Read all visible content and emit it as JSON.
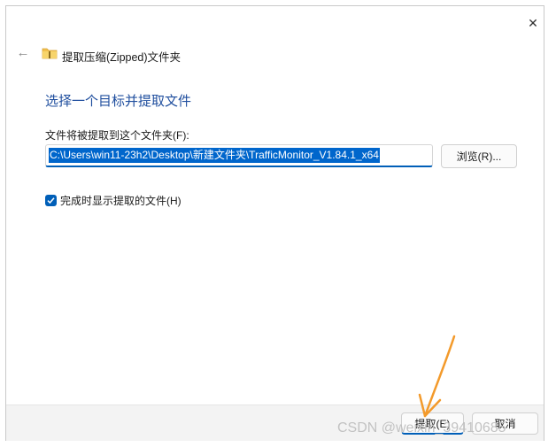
{
  "dialog": {
    "title": "提取压缩(Zipped)文件夹",
    "close_icon": "close-icon",
    "back_icon": "back-arrow-icon",
    "folder_icon": "zip-folder-icon"
  },
  "main": {
    "heading": "选择一个目标并提取文件",
    "destination_label": "文件将被提取到这个文件夹(F):",
    "destination_value": "C:\\Users\\win11-23h2\\Desktop\\新建文件夹\\TrafficMonitor_V1.84.1_x64",
    "browse_label": "浏览(R)...",
    "show_files_label": "完成时显示提取的文件(H)",
    "show_files_checked": true
  },
  "footer": {
    "extract_label": "提取(E)",
    "cancel_label": "取消"
  },
  "overlay": {
    "watermark": "CSDN @weixin_39410685",
    "annotation_arrow_color": "#f39a2b"
  },
  "colors": {
    "accent": "#005fb8",
    "heading": "#1f4e9e",
    "selection": "#0066cc"
  }
}
